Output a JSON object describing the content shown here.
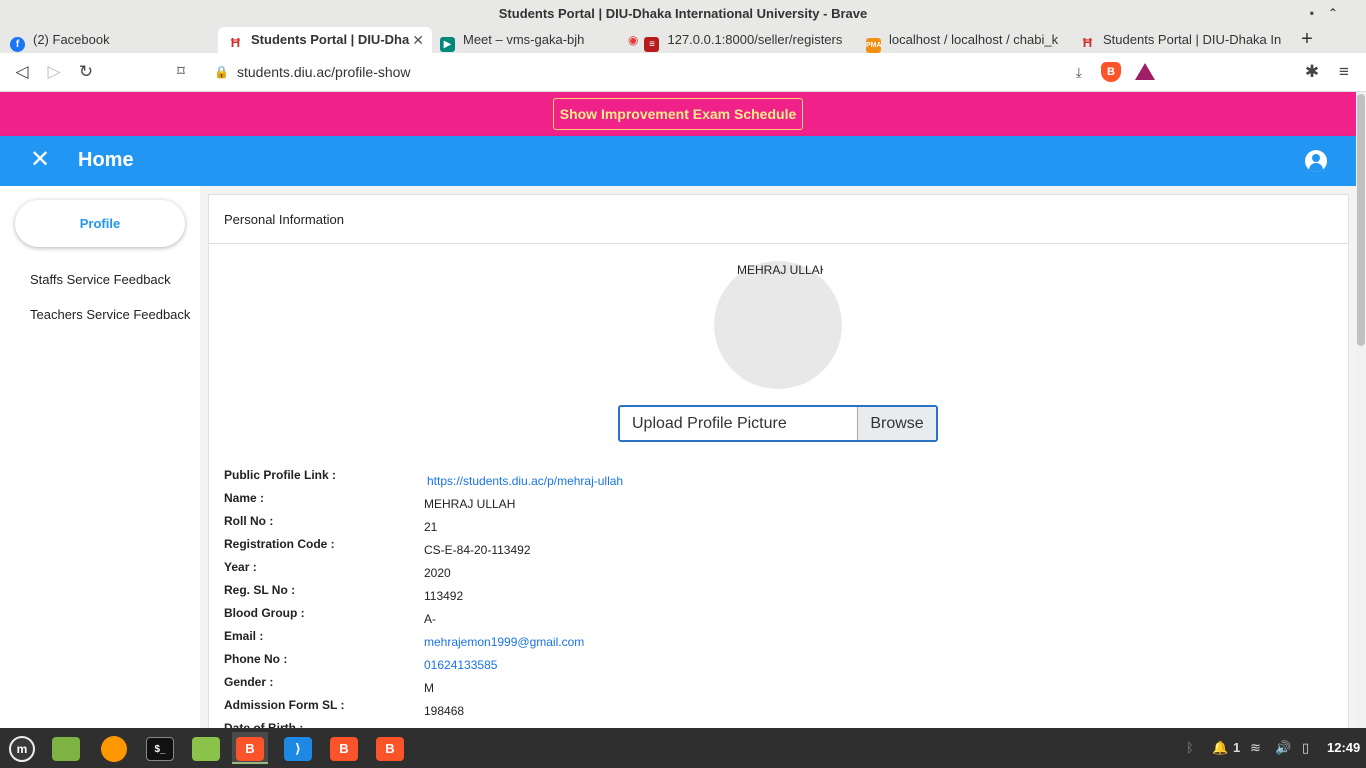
{
  "window": {
    "title": "Students Portal | DIU-Dhaka International University - Brave"
  },
  "tabs": [
    {
      "label": "(2) Facebook",
      "icon": "facebook-icon",
      "color": "#1877f2"
    },
    {
      "label": "Students Portal | DIU-Dha",
      "icon": "diu-icon",
      "color": "#d32f2f",
      "active": true
    },
    {
      "label": "Meet – vms-gaka-bjh",
      "icon": "meet-icon",
      "color": "#00897b"
    },
    {
      "label": "127.0.0.1:8000/seller/registers",
      "icon": "recording-icon",
      "color": "#e53935"
    },
    {
      "label": "localhost / localhost / chabi_k",
      "icon": "phpmyadmin-icon",
      "color": "#f29111"
    },
    {
      "label": "Students Portal | DIU-Dhaka In",
      "icon": "diu-icon",
      "color": "#d32f2f"
    }
  ],
  "address_bar": {
    "url": "students.diu.ac/profile-show"
  },
  "banner": {
    "button_label": "Show Improvement Exam Schedule"
  },
  "appbar": {
    "title": "Home"
  },
  "sidebar": {
    "active_item": "Profile",
    "items": [
      "Staffs Service Feedback",
      "Teachers Service Feedback"
    ]
  },
  "card": {
    "header": "Personal Information",
    "avatar_alt": "MEHRAJ ULLAH",
    "upload_placeholder": "Upload Profile Picture",
    "browse_label": "Browse"
  },
  "info": [
    {
      "label": "Public Profile Link :",
      "value": "https://students.diu.ac/p/mehraj-ullah",
      "link": true
    },
    {
      "label": "Name :",
      "value": "MEHRAJ ULLAH"
    },
    {
      "label": "Roll No :",
      "value": "21"
    },
    {
      "label": "Registration Code :",
      "value": "CS-E-84-20-113492"
    },
    {
      "label": "Year :",
      "value": "2020"
    },
    {
      "label": "Reg. SL No :",
      "value": "113492"
    },
    {
      "label": "Blood Group :",
      "value": "A-"
    },
    {
      "label": "Email :",
      "value": "mehrajemon1999@gmail.com",
      "link": true
    },
    {
      "label": "Phone No :",
      "value": "01624133585",
      "link": true
    },
    {
      "label": "Gender :",
      "value": "M"
    },
    {
      "label": "Admission Form SL :",
      "value": "198468"
    },
    {
      "label": "Date of Birth :",
      "value": ""
    }
  ],
  "taskbar": {
    "clock": "12:49",
    "notifications_count": "1"
  }
}
